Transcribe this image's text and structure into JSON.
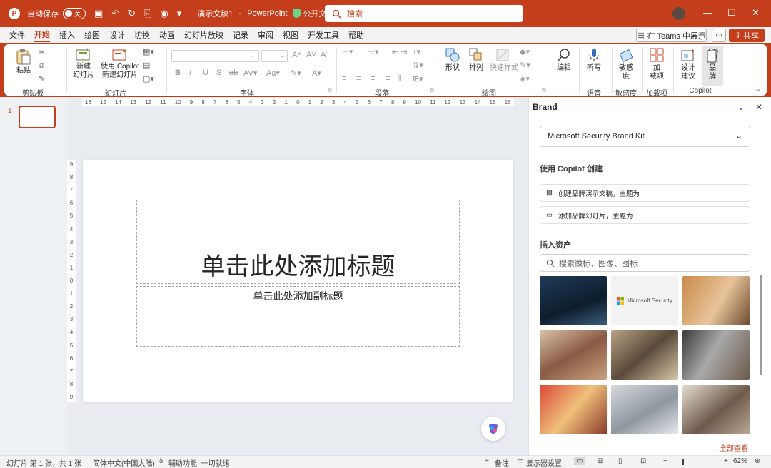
{
  "titlebar": {
    "autosave_label": "自动保存",
    "autosave_state": "关",
    "doc_name": "演示文稿1",
    "separator": "-",
    "app_name": "PowerPoint",
    "sensitivity_label": "公开文档*",
    "search_placeholder": "搜索"
  },
  "menu": {
    "tabs": [
      "文件",
      "开始",
      "插入",
      "绘图",
      "设计",
      "切换",
      "动画",
      "幻灯片放映",
      "记录",
      "审阅",
      "视图",
      "开发工具",
      "帮助"
    ],
    "active_tab": "开始",
    "present_teams": "在 Teams 中展示",
    "share": "共享"
  },
  "ribbon": {
    "paste": "粘贴",
    "new_slide_l1": "新建",
    "new_slide_l2": "幻灯片",
    "copilot_slide_l1": "使用 Copilot",
    "copilot_slide_l2": "新建幻灯片",
    "shapes": "形状",
    "arrange": "排列",
    "quick_styles": "快速样式",
    "edit": "编辑",
    "dictate": "听写",
    "sensitivity_l1": "敏感",
    "sensitivity_l2": "度",
    "addins_l1": "加",
    "addins_l2": "载项",
    "designer_l1": "设计",
    "designer_l2": "建议",
    "brand_l1": "品",
    "brand_l2": "牌",
    "groups": {
      "clipboard": "剪贴板",
      "slides": "幻灯片",
      "font": "字体",
      "paragraph": "段落",
      "drawing": "绘图",
      "voice": "语音",
      "sensitivity": "敏感度",
      "addins": "加载项",
      "copilot": "Copilot"
    }
  },
  "thumbnail": {
    "number": "1"
  },
  "ruler": {
    "horizontal": [
      "16",
      "15",
      "14",
      "13",
      "12",
      "11",
      "10",
      "9",
      "8",
      "7",
      "6",
      "5",
      "4",
      "3",
      "2",
      "1",
      "0",
      "1",
      "2",
      "3",
      "4",
      "5",
      "6",
      "7",
      "8",
      "9",
      "10",
      "11",
      "12",
      "13",
      "14",
      "15",
      "16"
    ],
    "vertical": [
      "9",
      "8",
      "7",
      "6",
      "5",
      "4",
      "3",
      "2",
      "1",
      "0",
      "1",
      "2",
      "3",
      "4",
      "5",
      "6",
      "7",
      "8",
      "9"
    ]
  },
  "slide": {
    "title_placeholder": "单击此处添加标题",
    "subtitle_placeholder": "单击此处添加副标题"
  },
  "brand_pane": {
    "title": "Brand",
    "kit_selected": "Microsoft Security Brand Kit",
    "copilot_heading": "使用 Copilot 创建",
    "action_create_deck": "创建品牌演示文稿，主题为",
    "action_add_slide": "添加品牌幻灯片，主题为",
    "assets_heading": "插入资产",
    "assets_search_placeholder": "搜索徽标、图像、图标",
    "logo_tile_text": "Microsoft Security",
    "see_all": "全部查看"
  },
  "statusbar": {
    "slide_info": "幻灯片 第 1 张，共 1 张",
    "language": "简体中文(中国大陆)",
    "accessibility": "辅助功能: 一切就绪",
    "notes": "备注",
    "display_settings": "显示器设置",
    "zoom": "62%"
  },
  "colors": {
    "accent": "#c43e1c",
    "canvas_bg": "#e9edf1",
    "ribbon_bg": "#f3f3f3"
  }
}
